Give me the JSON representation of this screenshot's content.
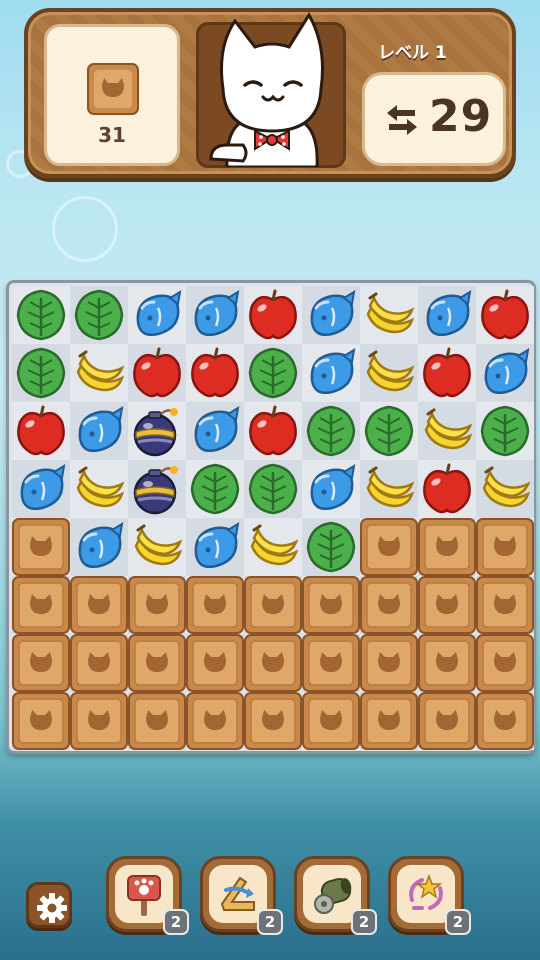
{
  "header": {
    "goal_count": "31",
    "level_label": "レベル 1",
    "moves_value": "29"
  },
  "board": {
    "rows": [
      [
        "leaf",
        "leaf",
        "fish",
        "fish",
        "apple",
        "fish",
        "banana",
        "fish",
        "apple"
      ],
      [
        "leaf",
        "banana",
        "apple",
        "apple",
        "leaf",
        "fish",
        "banana",
        "apple",
        "fish"
      ],
      [
        "apple",
        "fish",
        "bomb",
        "fish",
        "apple",
        "leaf",
        "leaf",
        "banana",
        "leaf"
      ],
      [
        "fish",
        "banana",
        "bomb",
        "leaf",
        "leaf",
        "fish",
        "banana",
        "apple",
        "banana"
      ],
      [
        "crate",
        "fish",
        "banana",
        "fish",
        "banana",
        "leaf",
        "crate",
        "crate",
        "crate"
      ],
      [
        "crate",
        "crate",
        "crate",
        "crate",
        "crate",
        "crate",
        "crate",
        "crate",
        "crate"
      ],
      [
        "crate",
        "crate",
        "crate",
        "crate",
        "crate",
        "crate",
        "crate",
        "crate",
        "crate"
      ],
      [
        "crate",
        "crate",
        "crate",
        "crate",
        "crate",
        "crate",
        "crate",
        "crate",
        "crate"
      ]
    ]
  },
  "boosters": [
    {
      "icon": "paw-hammer-icon",
      "count": "2"
    },
    {
      "icon": "boomerang-icon",
      "count": "2"
    },
    {
      "icon": "cannon-icon",
      "count": "2"
    },
    {
      "icon": "star-shuffle-icon",
      "count": "2"
    }
  ],
  "colors": {
    "wood": "#a8733f",
    "panel": "#fbf1dc",
    "board": "#dfe3e8"
  }
}
